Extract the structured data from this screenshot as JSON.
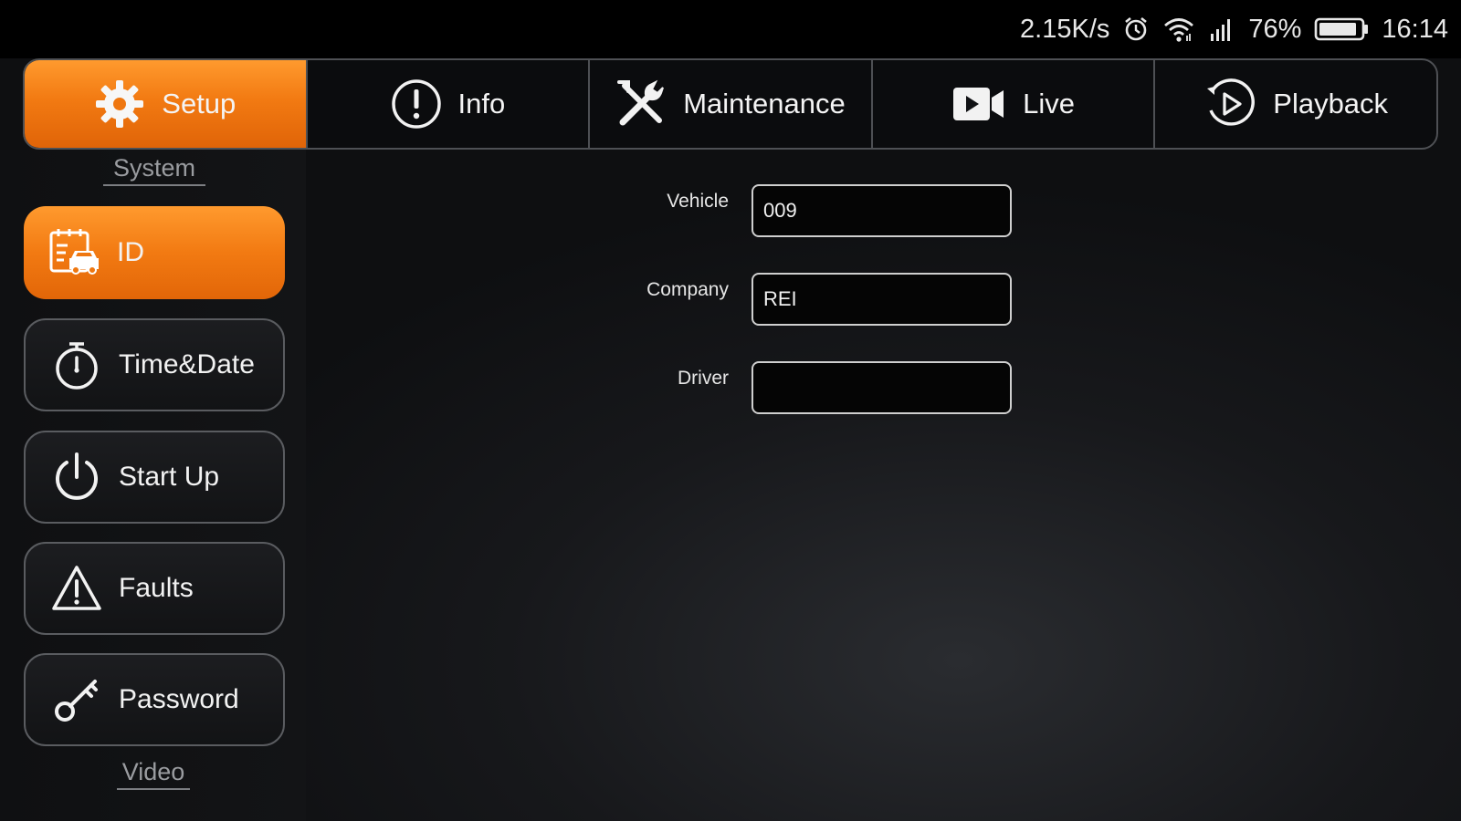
{
  "status_bar": {
    "net_speed": "2.15K/s",
    "battery_percent": "76%",
    "time": "16:14",
    "icons": [
      "alarm-icon",
      "wifi-icon",
      "signal-icon",
      "battery-icon"
    ]
  },
  "tabs": [
    {
      "label": "Setup",
      "icon": "gear-icon",
      "active": true
    },
    {
      "label": "Info",
      "icon": "info-icon",
      "active": false
    },
    {
      "label": "Maintenance",
      "icon": "tools-icon",
      "active": false
    },
    {
      "label": "Live",
      "icon": "video-camera-icon",
      "active": false
    },
    {
      "label": "Playback",
      "icon": "playback-icon",
      "active": false
    }
  ],
  "sidebar": {
    "section_system": "System",
    "section_video": "Video",
    "items": [
      {
        "label": "ID",
        "icon": "id-card-icon",
        "active": true
      },
      {
        "label": "Time&Date",
        "icon": "stopwatch-icon",
        "active": false
      },
      {
        "label": "Start Up",
        "icon": "power-icon",
        "active": false
      },
      {
        "label": "Faults",
        "icon": "warning-icon",
        "active": false
      },
      {
        "label": "Password",
        "icon": "key-icon",
        "active": false
      }
    ]
  },
  "form": {
    "vehicle": {
      "label": "Vehicle",
      "value": "009"
    },
    "company": {
      "label": "Company",
      "value": "REI"
    },
    "driver": {
      "label": "Driver",
      "value": ""
    }
  },
  "colors": {
    "accent": "#f27a12",
    "background": "#17181b",
    "border": "#5a5c60"
  }
}
